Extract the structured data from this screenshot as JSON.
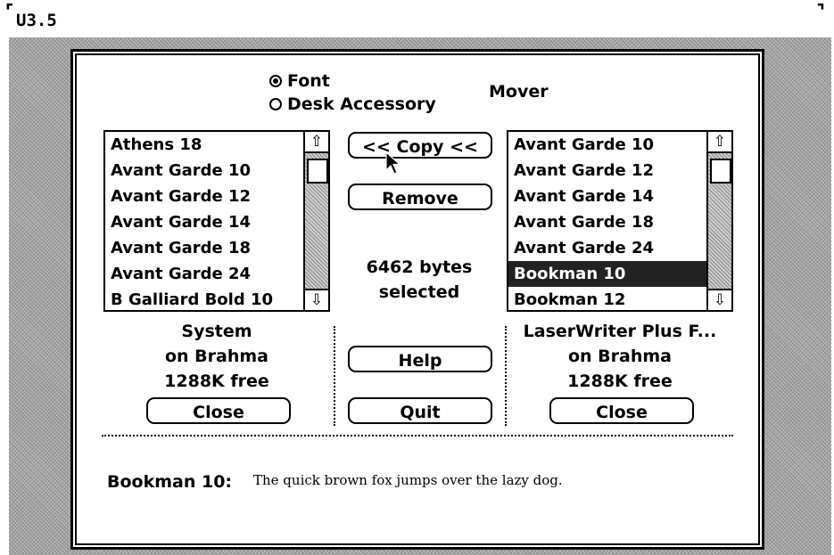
{
  "screen": {
    "version": "U3.5"
  },
  "font_mover": {
    "mode_options": [
      {
        "label": "Font",
        "selected": true
      },
      {
        "label": "Desk Accessory",
        "selected": false
      }
    ],
    "title": "Mover",
    "left_list": {
      "items": [
        "Athens 18",
        "Avant Garde 10",
        "Avant Garde 12",
        "Avant Garde 14",
        "Avant Garde 18",
        "Avant Garde 24",
        "B Galliard Bold 10"
      ],
      "file_name": "System",
      "volume": "on Brahma",
      "free_space": "1288K free",
      "close_label": "Close"
    },
    "right_list": {
      "items": [
        "Avant Garde 10",
        "Avant Garde 12",
        "Avant Garde 14",
        "Avant Garde 18",
        "Avant Garde 24",
        "Bookman 10",
        "Bookman 12"
      ],
      "selected_item": "Bookman 10",
      "file_name": "LaserWriter Plus F...",
      "volume": "on Brahma",
      "free_space": "1288K free",
      "close_label": "Close"
    },
    "copy_label": "<< Copy <<",
    "remove_label": "Remove",
    "selection_size": "6462 bytes",
    "selection_suffix": "selected",
    "help_label": "Help",
    "quit_label": "Quit",
    "sample": {
      "label": "Bookman 10:",
      "text": "The quick brown fox jumps over the lazy dog."
    }
  }
}
